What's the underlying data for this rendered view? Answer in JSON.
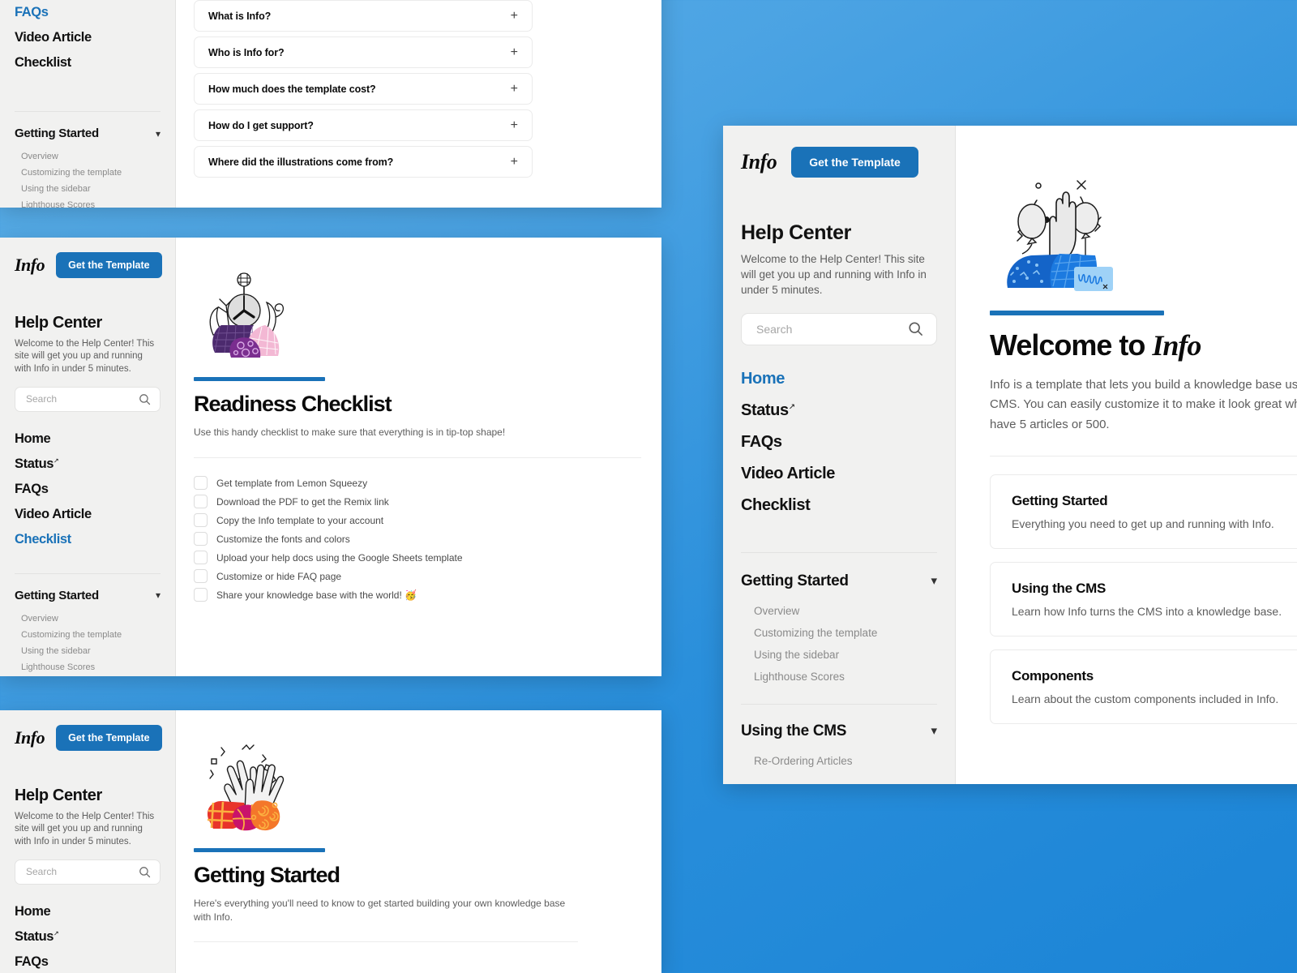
{
  "brand": {
    "logo": "Info",
    "template_button": "Get the Template",
    "accent_color": "#1a72b8",
    "background_color": "#2a8fdb"
  },
  "sidebar": {
    "title": "Help Center",
    "description": "Welcome to the Help Center! This site will get you up and running with Info in under 5 minutes.",
    "search": {
      "value": "",
      "placeholder": "Search",
      "icon": "search-icon"
    },
    "nav": [
      {
        "label": "Home",
        "external": false
      },
      {
        "label": "Status",
        "external": true
      },
      {
        "label": "FAQs",
        "external": false
      },
      {
        "label": "Video Article",
        "external": false
      },
      {
        "label": "Checklist",
        "external": false
      }
    ],
    "groups": [
      {
        "label": "Getting Started",
        "chevron": "chevron-down-icon",
        "items": [
          "Overview",
          "Customizing the template",
          "Using the sidebar",
          "Lighthouse Scores"
        ]
      },
      {
        "label": "Using the CMS",
        "chevron": "chevron-down-icon",
        "items": [
          "Re-Ordering Articles"
        ]
      }
    ]
  },
  "panel_faq": {
    "active_nav": "FAQs",
    "nav_visible": [
      "FAQs",
      "Video Article",
      "Checklist"
    ],
    "group": {
      "label": "Getting Started",
      "items": [
        "Overview",
        "Customizing the template",
        "Using the sidebar",
        "Lighthouse Scores"
      ]
    },
    "items": [
      {
        "question": "What is Info?",
        "toggle": "+"
      },
      {
        "question": "Who is Info for?",
        "toggle": "+"
      },
      {
        "question": "How much does the template cost?",
        "toggle": "+"
      },
      {
        "question": "How do I get support?",
        "toggle": "+"
      },
      {
        "question": "Where did the illustrations come from?",
        "toggle": "+"
      }
    ]
  },
  "panel_checklist": {
    "active_nav": "Checklist",
    "illustration": "purple-clock-plants-illustration",
    "title": "Readiness Checklist",
    "subtitle": "Use this handy checklist to make sure that everything is in tip-top shape!",
    "items": [
      "Get template from Lemon Squeezy",
      "Download the PDF to get the Remix link",
      "Copy the Info template to your account",
      "Customize the fonts and colors",
      "Upload your help docs using the Google Sheets template",
      "Customize or hide FAQ page",
      "Share your knowledge base with the world! 🥳"
    ]
  },
  "panel_getting_started": {
    "illustration": "orange-hands-clapping-illustration",
    "title": "Getting Started",
    "subtitle": "Here's everything you'll need to know to get started building your own knowledge base with Info."
  },
  "panel_home": {
    "active_nav": "Home",
    "illustration": "blue-raised-hand-balloons-illustration",
    "title_prefix": "Welcome to ",
    "title_brand": "Info",
    "intro": "Info is a template that lets you build a knowledge base using Framer's CMS. You can easily customize it to make it look great whether you have 5 articles or 500.",
    "cards": [
      {
        "title": "Getting Started",
        "description": "Everything you need to get up and running with Info."
      },
      {
        "title": "Using the CMS",
        "description": "Learn how Info turns the CMS into a knowledge base."
      },
      {
        "title": "Components",
        "description": "Learn about the custom components included in Info."
      }
    ]
  }
}
